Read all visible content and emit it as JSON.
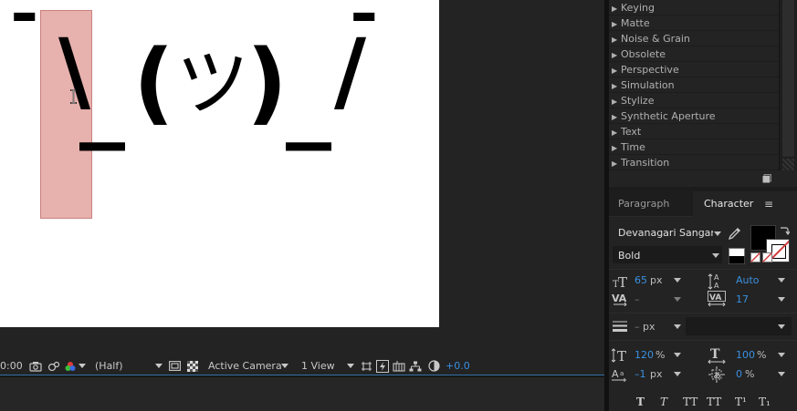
{
  "viewer": {
    "art": {
      "hand_left": "¯",
      "slash_left": "\\",
      "under_left": "_",
      "paren_left": "(",
      "tsu": "ツ",
      "paren_right": ")",
      "under_right": "_",
      "slash_right": "/",
      "hand_right": "¯"
    }
  },
  "toolbar": {
    "timecode": "0:00",
    "resolution": "(Half)",
    "camera": "Active Camera",
    "views": "1 View",
    "exposure": "+0.0"
  },
  "effects": {
    "items": [
      {
        "label": "Keying"
      },
      {
        "label": "Matte"
      },
      {
        "label": "Noise & Grain"
      },
      {
        "label": "Obsolete"
      },
      {
        "label": "Perspective"
      },
      {
        "label": "Simulation"
      },
      {
        "label": "Stylize"
      },
      {
        "label": "Synthetic Aperture"
      },
      {
        "label": "Text"
      },
      {
        "label": "Time"
      },
      {
        "label": "Transition"
      }
    ],
    "arrow": "▶"
  },
  "character_panel": {
    "tabs": {
      "paragraph": "Paragraph",
      "character": "Character",
      "menu": "≡"
    },
    "font_family": "Devanagari Sangam",
    "font_style": "Bold",
    "font_size": {
      "value": "65",
      "unit": "px"
    },
    "leading": {
      "value": "Auto"
    },
    "kerning": {
      "value": "–"
    },
    "tracking": {
      "value": "17"
    },
    "stroke_width": {
      "value": "–",
      "unit": "px"
    },
    "vertical_scale": {
      "value": "120",
      "unit": "%"
    },
    "horizontal_scale": {
      "value": "100",
      "unit": "%"
    },
    "baseline_shift": {
      "value": "–1",
      "unit": "px"
    },
    "tsume": {
      "value": "0",
      "unit": "%"
    },
    "type_styles": [
      "T",
      "T",
      "TT",
      "TT",
      "T¹",
      "T₁"
    ],
    "colors": {
      "fill": "#000000",
      "stroke": "#ffffff",
      "accent": "#3a90e0"
    }
  }
}
